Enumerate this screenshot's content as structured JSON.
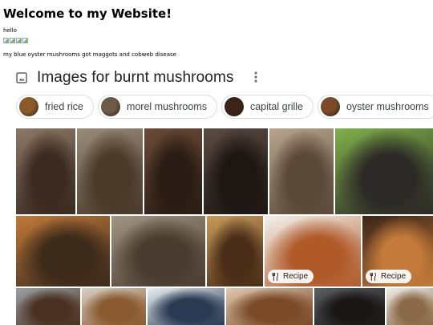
{
  "page": {
    "heading": "Welcome to my Website!",
    "greeting": "hello",
    "caption": "my blue oyster mushrooms got maggots and cobweb disease",
    "broken_images": [
      "broken-image-icon",
      "broken-image-icon",
      "broken-image-icon",
      "broken-image-icon"
    ]
  },
  "image_pack": {
    "header_icon": "image-icon",
    "title": "Images for burnt mushrooms",
    "menu_icon": "more-vertical-icon",
    "chips": [
      {
        "label": "fried rice",
        "thumb_color": "#8a5a2b"
      },
      {
        "label": "morel mushrooms",
        "thumb_color": "#6d5a47"
      },
      {
        "label": "capital grille",
        "thumb_color": "#3a2418"
      },
      {
        "label": "oyster mushrooms",
        "thumb_color": "#7a4a2a"
      }
    ],
    "tiles": [
      {
        "name": "tile-roasted-tray",
        "colors": [
          "#8d7866",
          "#3a2a20"
        ],
        "badge": ""
      },
      {
        "name": "tile-morel-forest",
        "colors": [
          "#9a8a78",
          "#4a3a2a"
        ],
        "badge": ""
      },
      {
        "name": "tile-dark-caps",
        "colors": [
          "#6b4a36",
          "#2a1c14"
        ],
        "badge": ""
      },
      {
        "name": "tile-cast-iron-pan",
        "colors": [
          "#5a4a42",
          "#1e1612"
        ],
        "badge": ""
      },
      {
        "name": "tile-morels-sign",
        "colors": [
          "#b8a48c",
          "#5a4838"
        ],
        "badge": ""
      },
      {
        "name": "tile-charred-mushroom-grass",
        "colors": [
          "#7fb04a",
          "#2c2a26"
        ],
        "badge": ""
      },
      {
        "name": "tile-brown-caps-closeup",
        "colors": [
          "#c07a3a",
          "#3c2a1a"
        ],
        "badge": ""
      },
      {
        "name": "tile-morel-ground",
        "colors": [
          "#a09482",
          "#4a3c30"
        ],
        "badge": ""
      },
      {
        "name": "tile-crispy-pieces",
        "colors": [
          "#c89a5a",
          "#4a2e18"
        ],
        "badge": ""
      },
      {
        "name": "tile-plated-herbs",
        "colors": [
          "#f4f1ec",
          "#b05a2a"
        ],
        "badge": "Recipe"
      },
      {
        "name": "tile-fried-slices",
        "colors": [
          "#3a2418",
          "#c47a3a"
        ],
        "badge": "Recipe"
      },
      {
        "name": "tile-sheet-pan",
        "colors": [
          "#9aa0a4",
          "#4a3020"
        ],
        "badge": ""
      },
      {
        "name": "tile-sauteed-bowl",
        "colors": [
          "#d8cfc2",
          "#8a5a30"
        ],
        "badge": ""
      },
      {
        "name": "tile-blue-dish",
        "colors": [
          "#e8eef2",
          "#2a3a52"
        ],
        "badge": ""
      },
      {
        "name": "tile-forks-plate",
        "colors": [
          "#e0c8b0",
          "#7a4a28"
        ],
        "badge": ""
      },
      {
        "name": "tile-dark-pan",
        "colors": [
          "#5a5e62",
          "#1a1614"
        ],
        "badge": ""
      },
      {
        "name": "tile-white-bowl",
        "colors": [
          "#f0ece6",
          "#8a6a48"
        ],
        "badge": ""
      }
    ]
  }
}
